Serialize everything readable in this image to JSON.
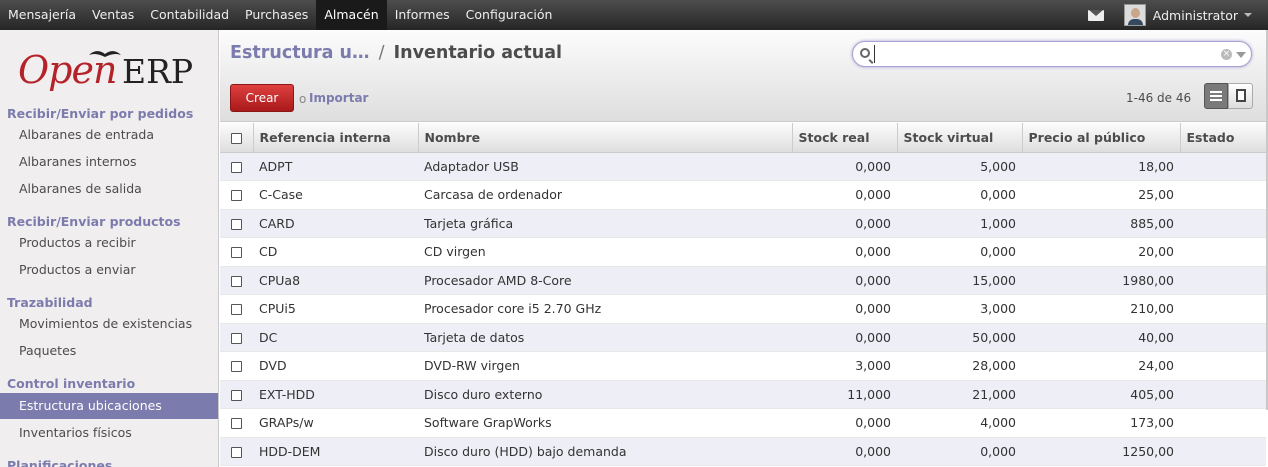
{
  "topmenu": [
    "Mensajería",
    "Ventas",
    "Contabilidad",
    "Purchases",
    "Almacén",
    "Informes",
    "Configuración"
  ],
  "active_menu": "Almacén",
  "user": "Administrator",
  "logo": {
    "open": "Open",
    "erp": "ERP"
  },
  "sidebar": {
    "sections": [
      {
        "title": "Recibir/Enviar por pedidos",
        "items": [
          "Albaranes de entrada",
          "Albaranes internos",
          "Albaranes de salida"
        ]
      },
      {
        "title": "Recibir/Enviar productos",
        "items": [
          "Productos a recibir",
          "Productos a enviar"
        ]
      },
      {
        "title": "Trazabilidad",
        "items": [
          "Movimientos de existencias",
          "Paquetes"
        ]
      },
      {
        "title": "Control inventario",
        "items": [
          "Estructura ubicaciones",
          "Inventarios físicos"
        ]
      },
      {
        "title": "Planificaciones",
        "items": []
      }
    ],
    "active_item": "Estructura ubicaciones"
  },
  "breadcrumb": {
    "parent": "Estructura u…",
    "separator": "/",
    "current": "Inventario actual"
  },
  "search": {
    "value": "",
    "clear": "×"
  },
  "toolbar": {
    "create": "Crear",
    "or": "o",
    "import": "Importar",
    "pager": "1-46 de 46"
  },
  "colors": {
    "accent": "#7c7bad",
    "create_button": "#c42727",
    "topbar": "#333333"
  },
  "table": {
    "columns": [
      "Referencia interna",
      "Nombre",
      "Stock real",
      "Stock virtual",
      "Precio al público",
      "Estado"
    ],
    "rows": [
      [
        "ADPT",
        "Adaptador USB",
        "0,000",
        "5,000",
        "18,00",
        ""
      ],
      [
        "C-Case",
        "Carcasa de ordenador",
        "0,000",
        "0,000",
        "25,00",
        ""
      ],
      [
        "CARD",
        "Tarjeta gráfica",
        "0,000",
        "1,000",
        "885,00",
        ""
      ],
      [
        "CD",
        "CD virgen",
        "0,000",
        "0,000",
        "20,00",
        ""
      ],
      [
        "CPUa8",
        "Procesador AMD 8-Core",
        "0,000",
        "15,000",
        "1980,00",
        ""
      ],
      [
        "CPUi5",
        "Procesador core i5 2.70 GHz",
        "0,000",
        "3,000",
        "210,00",
        ""
      ],
      [
        "DC",
        "Tarjeta de datos",
        "0,000",
        "50,000",
        "40,00",
        ""
      ],
      [
        "DVD",
        "DVD-RW virgen",
        "3,000",
        "28,000",
        "24,00",
        ""
      ],
      [
        "EXT-HDD",
        "Disco duro externo",
        "11,000",
        "21,000",
        "405,00",
        ""
      ],
      [
        "GRAPs/w",
        "Software GrapWorks",
        "0,000",
        "4,000",
        "173,00",
        ""
      ],
      [
        "HDD-DEM",
        "Disco duro (HDD) bajo demanda",
        "0,000",
        "0,000",
        "1250,00",
        ""
      ]
    ]
  }
}
